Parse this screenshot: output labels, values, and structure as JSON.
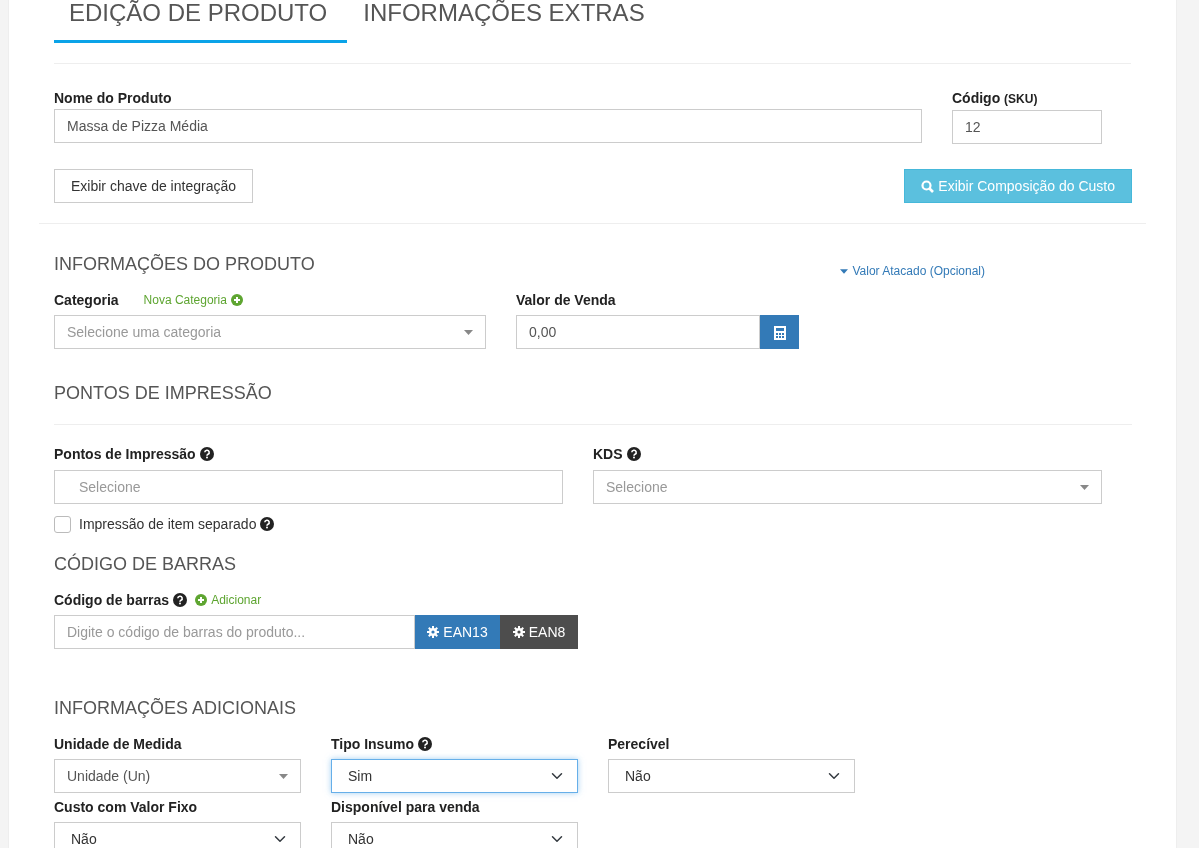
{
  "tabs": [
    {
      "label": "EDIÇÃO DE PRODUTO",
      "selected": true
    },
    {
      "label": "INFORMAÇÕES EXTRAS",
      "selected": false
    }
  ],
  "product": {
    "name_label": "Nome do Produto",
    "name_value": "Massa de Pizza Média",
    "sku_label": "Código",
    "sku_suffix": "(SKU)",
    "sku_value": "12",
    "integration_button": "Exibir chave de integração",
    "cost_button": "Exibir Composição do Custo"
  },
  "product_info": {
    "title": "INFORMAÇÕES DO PRODUTO",
    "category_label": "Categoria",
    "new_category_link": "Nova Categoria",
    "category_placeholder": "Selecione uma categoria",
    "wholesale_link": "Valor Atacado (Opcional)",
    "price_label": "Valor de Venda",
    "price_value": "0,00"
  },
  "print_points": {
    "title": "PONTOS DE IMPRESSÃO",
    "points_label": "Pontos de Impressão",
    "points_placeholder": "Selecione",
    "kds_label": "KDS",
    "kds_placeholder": "Selecione",
    "separate_label": "Impressão de item separado",
    "separate_checked": false
  },
  "barcode": {
    "title": "CÓDIGO DE BARRAS",
    "label": "Código de barras",
    "add_link": "Adicionar",
    "placeholder": "Digite o código de barras do produto...",
    "buttons": [
      "EAN13",
      "EAN8"
    ]
  },
  "additional": {
    "title": "INFORMAÇÕES ADICIONAIS",
    "fields": [
      {
        "label": "Unidade de Medida",
        "help": false,
        "kind": "combo",
        "value": "Unidade (Un)",
        "focused": false
      },
      {
        "label": "Tipo Insumo",
        "help": true,
        "kind": "select",
        "value": "Sim",
        "focused": true
      },
      {
        "label": "Perecível",
        "help": false,
        "kind": "select",
        "value": "Não",
        "focused": false
      },
      {
        "label": "Custo com Valor Fixo",
        "help": false,
        "kind": "select",
        "value": "Não",
        "focused": false
      },
      {
        "label": "Disponível para venda",
        "help": false,
        "kind": "select",
        "value": "Não",
        "focused": false
      }
    ]
  }
}
